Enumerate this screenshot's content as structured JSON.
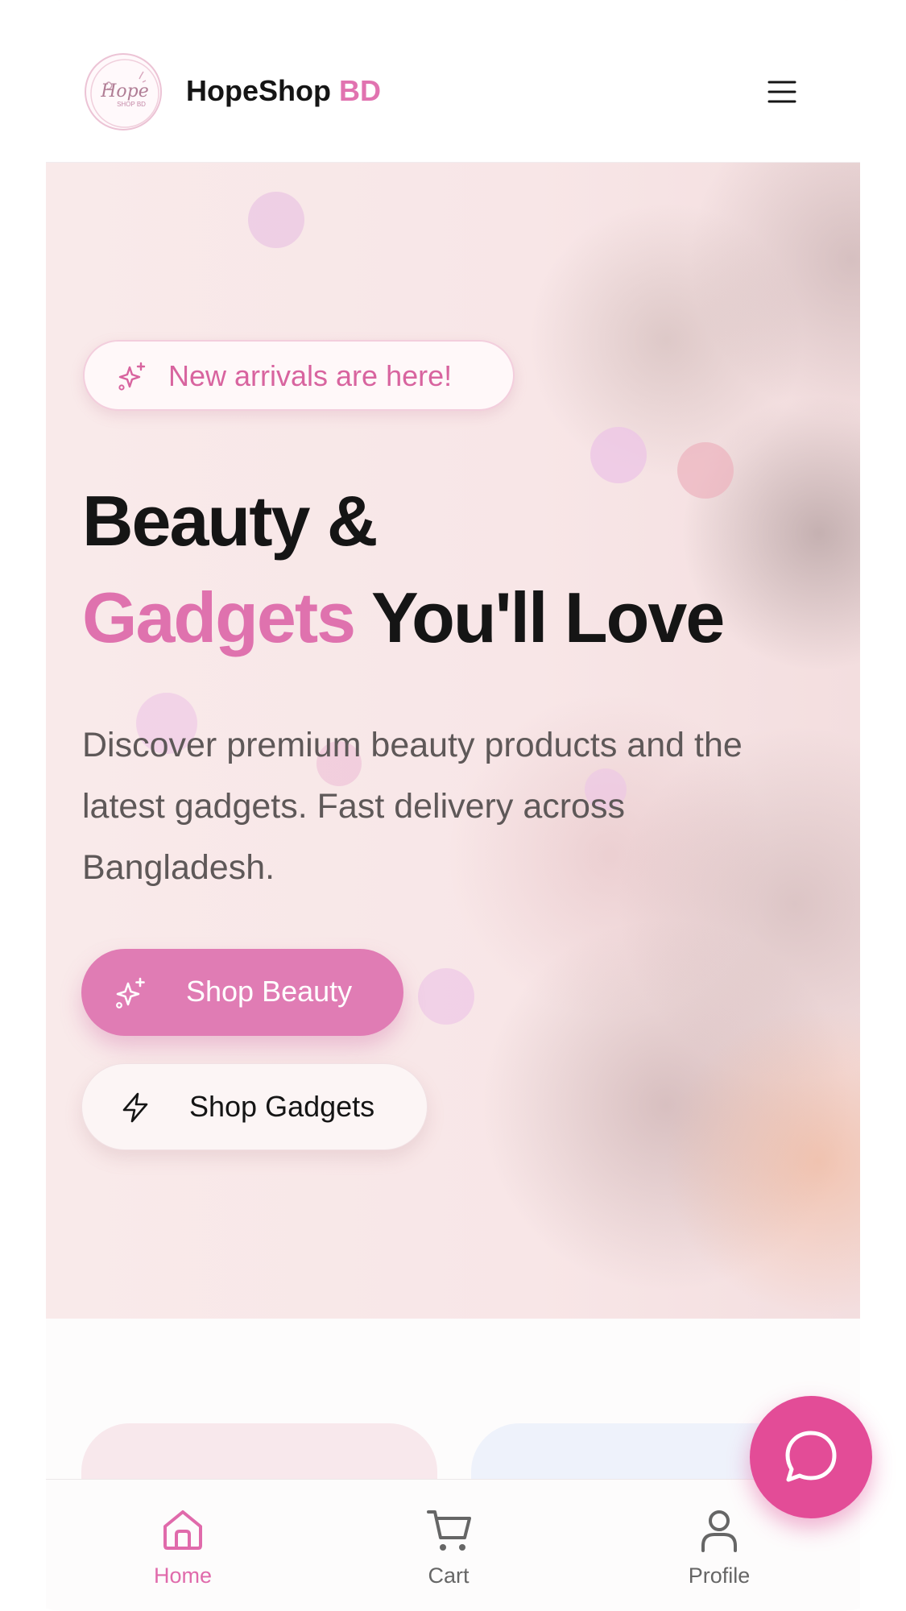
{
  "header": {
    "logo_text": "Hope",
    "logo_subtext": "SHOP BD",
    "brand_name": "HopeShop",
    "brand_suffix": "BD",
    "menu_icon": "hamburger-menu-icon"
  },
  "hero": {
    "badge_icon": "sparkles-icon",
    "badge_text": "New arrivals are here!",
    "headline_line1": "Beauty &",
    "headline_highlight": "Gadgets",
    "headline_rest": " You'll Love",
    "description": "Discover premium beauty products and the latest gadgets. Fast delivery across Bangladesh.",
    "primary_button": {
      "label": "Shop Beauty",
      "icon": "sparkles-icon",
      "color": "#e07cb4"
    },
    "secondary_button": {
      "label": "Shop Gadgets",
      "icon": "lightning-icon"
    }
  },
  "bottom_nav": {
    "items": [
      {
        "label": "Home",
        "icon": "home-icon",
        "active": true
      },
      {
        "label": "Cart",
        "icon": "cart-icon",
        "active": false
      },
      {
        "label": "Profile",
        "icon": "user-icon",
        "active": false
      }
    ],
    "active_color": "#e06aab"
  },
  "chat_fab": {
    "icon": "chat-bubble-icon",
    "color": "#e34c97"
  },
  "colors": {
    "accent": "#df72ae",
    "text_dark": "#151515",
    "text_muted": "#5e5858"
  }
}
